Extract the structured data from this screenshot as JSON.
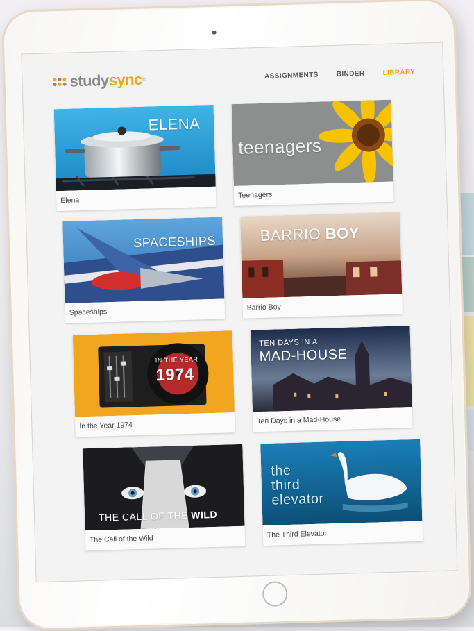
{
  "app": {
    "logo_text": "study",
    "logo_accent": "sync",
    "logo_mark": "®"
  },
  "nav": {
    "items": [
      "ASSIGNMENTS",
      "BINDER",
      "LIBRARY"
    ],
    "active": "LIBRARY"
  },
  "colors": {
    "accent": "#f0a81a",
    "text": "#555555"
  },
  "library": {
    "items": [
      {
        "label": "Elena",
        "cover_title": "ELENA"
      },
      {
        "label": "Teenagers",
        "cover_title": "teenagers"
      },
      {
        "label": "Spaceships",
        "cover_title": "SPACESHIPS"
      },
      {
        "label": "Barrio Boy",
        "cover_title_a": "BARRIO",
        "cover_title_b": "BOY"
      },
      {
        "label": "In the Year 1974",
        "cover_title_a": "IN THE YEAR",
        "cover_title_b": "1974"
      },
      {
        "label": "Ten Days in a Mad-House",
        "cover_title_a": "TEN DAYS IN A",
        "cover_title_b": "MAD-HOUSE"
      },
      {
        "label": "The Call of the Wild",
        "cover_title_a": "THE CALL OF THE",
        "cover_title_b": "WILD"
      },
      {
        "label": "The Third Elevator",
        "cover_title_a": "the",
        "cover_title_b": "third",
        "cover_title_c": "elevator"
      }
    ]
  }
}
